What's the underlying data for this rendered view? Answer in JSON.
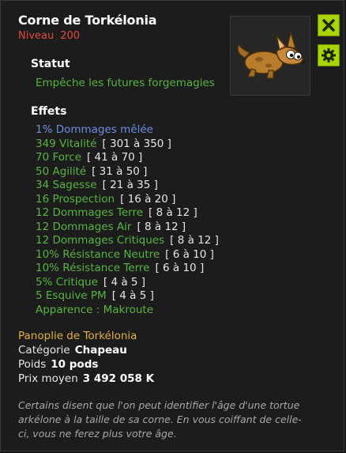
{
  "item": {
    "name": "Corne de Torkélonia",
    "level_label": "Niveau",
    "level": "200"
  },
  "statut": {
    "label": "Statut",
    "text": "Empêche les futures forgemagies"
  },
  "effets": {
    "label": "Effets",
    "items": [
      {
        "name": "1% Dommages mêlée",
        "range": "",
        "style": "blue"
      },
      {
        "name": "349 Vitalité",
        "range": "[ 301 à 350 ]",
        "style": "green"
      },
      {
        "name": "70 Force",
        "range": "[ 41 à 70 ]",
        "style": "green"
      },
      {
        "name": "50 Agilité",
        "range": "[ 31 à 50 ]",
        "style": "green"
      },
      {
        "name": "34 Sagesse",
        "range": "[ 21 à 35 ]",
        "style": "green"
      },
      {
        "name": "16 Prospection",
        "range": "[ 16 à 20 ]",
        "style": "green"
      },
      {
        "name": "12 Dommages Terre",
        "range": "[ 8 à 12 ]",
        "style": "green"
      },
      {
        "name": "12 Dommages Air",
        "range": "[ 8 à 12 ]",
        "style": "green"
      },
      {
        "name": "12 Dommages Critiques",
        "range": "[ 8 à 12 ]",
        "style": "green"
      },
      {
        "name": "10% Résistance Neutre",
        "range": "[ 6 à 10 ]",
        "style": "green"
      },
      {
        "name": "10% Résistance Terre",
        "range": "[ 6 à 10 ]",
        "style": "green"
      },
      {
        "name": "5% Critique",
        "range": "[ 4 à 5 ]",
        "style": "green"
      },
      {
        "name": "5 Esquive PM",
        "range": "[ 4 à 5 ]",
        "style": "green"
      },
      {
        "name": "Apparence : Makroute",
        "range": "",
        "style": "green"
      }
    ]
  },
  "panoplie": "Panoplie de Torkélonia",
  "info": {
    "categorie_label": "Catégorie",
    "categorie_value": "Chapeau",
    "poids_label": "Poids",
    "poids_value": "10 pods",
    "prix_label": "Prix moyen",
    "prix_value": "3 492 058 K"
  },
  "description": "Certains disent que l'on peut identifier l'âge d'une tortue arkélone à la taille de sa corne. En vous coiffant de celle-ci, vous ne ferez plus votre âge.",
  "icons": {
    "close": "close-icon",
    "settings": "gear-icon",
    "item": "fox-creature-illustration"
  },
  "colors": {
    "accent": "#a8d400",
    "effect_green": "#57b43e",
    "effect_blue": "#6c8fe0",
    "level_red": "#e04a3a",
    "panoplie_gold": "#e0b23a"
  }
}
